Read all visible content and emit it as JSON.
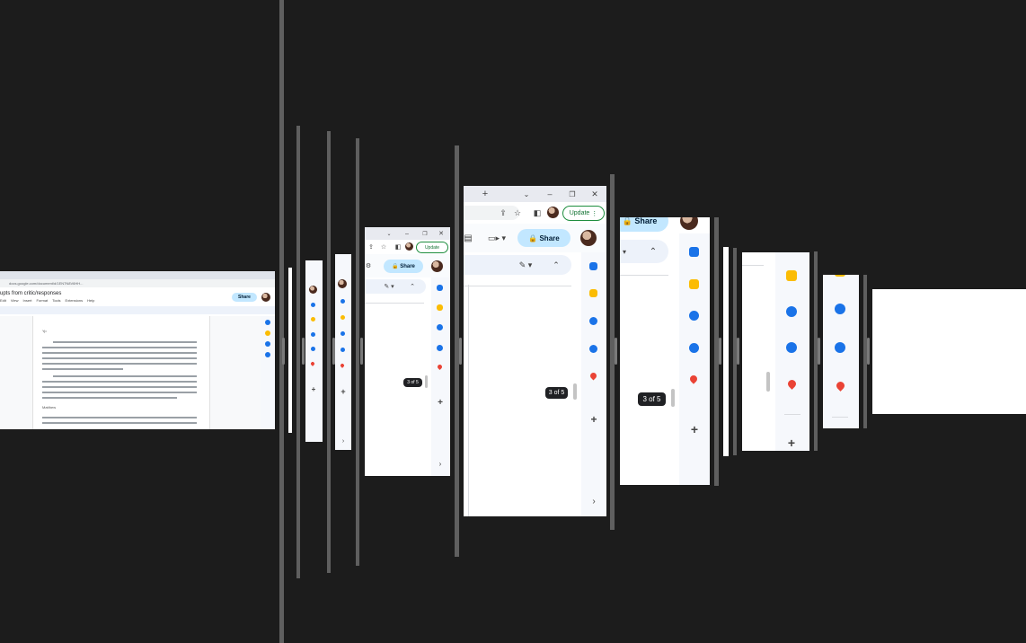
{
  "docs_window": {
    "url": "docs.google.com/document/d/1EN7N8V6HH...",
    "title": "upts from critic/responses",
    "menu": [
      "Edit",
      "View",
      "Insert",
      "Format",
      "Tools",
      "Extensions",
      "Help"
    ],
    "share_label": "Share",
    "doc_heading_1": "Yp",
    "doc_heading_2": "Matthew"
  },
  "share_label": "Share",
  "update_label": "Update",
  "tab_counter": "3 of 5",
  "add_label": "+",
  "colors": {
    "background": "#1c1c1c",
    "share_pill": "#c2e7ff",
    "update_border": "#1e8e3e",
    "calendar": "#1a73e8",
    "keep": "#fbbc04",
    "maps": "#ea4335"
  }
}
